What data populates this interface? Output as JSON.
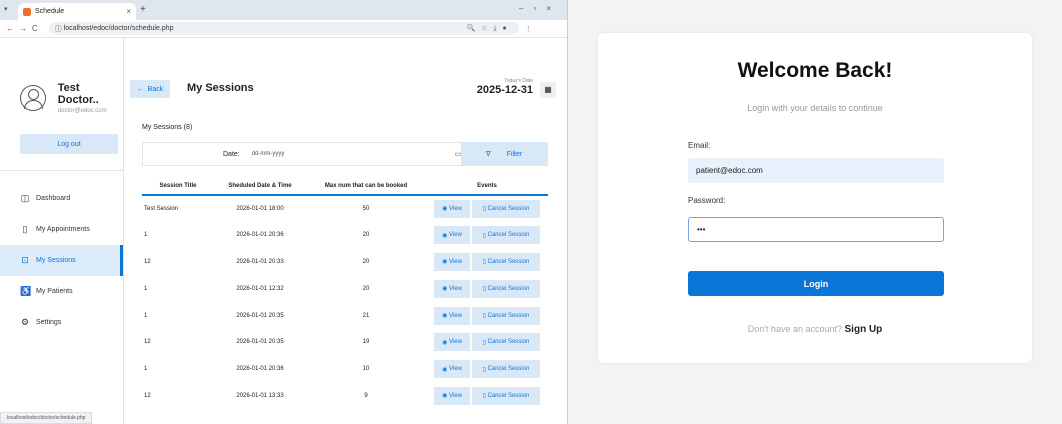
{
  "browser": {
    "tab_title": "Schedule",
    "url": "localhost/edoc/doctor/schedule.php",
    "status_url": "localhost/edoc/doctor/schedule.php"
  },
  "sidebar": {
    "name": "Test Doctor..",
    "email": "doctor@edoc.com",
    "logout": "Log out",
    "items": [
      {
        "label": "Dashboard",
        "icon": "dashboard-icon"
      },
      {
        "label": "My Appointments",
        "icon": "bookmark-icon"
      },
      {
        "label": "My Sessions",
        "icon": "session-icon"
      },
      {
        "label": "My Patients",
        "icon": "patients-icon"
      },
      {
        "label": "Settings",
        "icon": "gear-icon"
      }
    ]
  },
  "main": {
    "back": "Back",
    "title": "My Sessions",
    "today_label": "Today's Date",
    "today": "2025-12-31",
    "count": "My Sessions (8)",
    "date_label": "Date:",
    "date_placeholder": "dd-mm-yyyy",
    "filter": "Filter",
    "columns": [
      "Session Title",
      "Sheduled Date & Time",
      "Max num that can be booked",
      "Events"
    ],
    "view": "View",
    "cancel": "Cancel Session",
    "rows": [
      [
        "Test Session",
        "2026-01-01 18:00",
        "50"
      ],
      [
        "1",
        "2026-01-01 20:36",
        "20"
      ],
      [
        "12",
        "2026-01-01 20:33",
        "20"
      ],
      [
        "1",
        "2026-01-01 12:32",
        "20"
      ],
      [
        "1",
        "2026-01-01 20:35",
        "21"
      ],
      [
        "12",
        "2026-01-01 20:35",
        "19"
      ],
      [
        "1",
        "2026-01-01 20:36",
        "10"
      ],
      [
        "12",
        "2026-01-01 13:33",
        "9"
      ]
    ]
  },
  "login": {
    "title": "Welcome Back!",
    "subtitle": "Login with your details to continue",
    "email_label": "Email:",
    "email_value": "patient@edoc.com",
    "password_label": "Password:",
    "password_value": "•••",
    "button": "Login",
    "signup_text": "Don't have an account?",
    "signup_link": "Sign Up"
  }
}
